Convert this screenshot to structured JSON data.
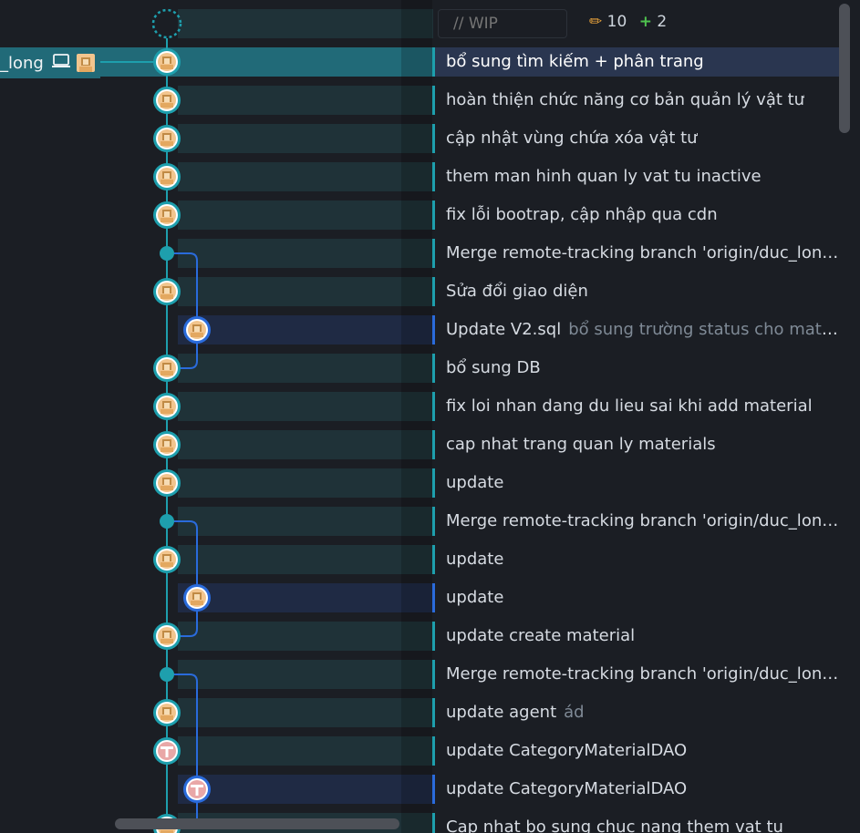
{
  "wip": {
    "placeholder": "// WIP",
    "edit_count": "10",
    "add_count": "2"
  },
  "branch": {
    "label": "_long"
  },
  "commits": [
    {
      "message": "bổ sung tìm kiếm + phân trang",
      "sub": "",
      "lane": 0,
      "avatar": "face",
      "selected": true
    },
    {
      "message": "hoàn thiện chức năng cơ bản quản lý vật tư",
      "sub": "",
      "lane": 0,
      "avatar": "face"
    },
    {
      "message": "cập nhật vùng chứa xóa vật tư",
      "sub": "",
      "lane": 0,
      "avatar": "face"
    },
    {
      "message": "them man hinh quan ly vat tu inactive",
      "sub": "",
      "lane": 0,
      "avatar": "face"
    },
    {
      "message": "fix lỗi bootrap, cập nhập qua cdn",
      "sub": "",
      "lane": 0,
      "avatar": "face"
    },
    {
      "message": "Merge remote-tracking branch 'origin/duc_long' in...",
      "sub": "",
      "lane": 0,
      "avatar": "merge"
    },
    {
      "message": "Sửa đổi giao diện",
      "sub": "",
      "lane": 0,
      "avatar": "face"
    },
    {
      "message": "Update V2.sql",
      "sub": "bổ sung trường status cho material",
      "lane": 1,
      "avatar": "face"
    },
    {
      "message": "bổ sung DB",
      "sub": "",
      "lane": 0,
      "avatar": "face"
    },
    {
      "message": "fix loi nhan dang du lieu sai khi add material",
      "sub": "",
      "lane": 0,
      "avatar": "face"
    },
    {
      "message": "cap nhat trang quan ly materials",
      "sub": "",
      "lane": 0,
      "avatar": "face"
    },
    {
      "message": "update",
      "sub": "",
      "lane": 0,
      "avatar": "face"
    },
    {
      "message": "Merge remote-tracking branch 'origin/duc_long' in...",
      "sub": "",
      "lane": 0,
      "avatar": "merge"
    },
    {
      "message": "update",
      "sub": "",
      "lane": 0,
      "avatar": "face"
    },
    {
      "message": "update",
      "sub": "",
      "lane": 1,
      "avatar": "face"
    },
    {
      "message": "update create material",
      "sub": "",
      "lane": 0,
      "avatar": "face"
    },
    {
      "message": "Merge remote-tracking branch 'origin/duc_long' in...",
      "sub": "",
      "lane": 0,
      "avatar": "merge"
    },
    {
      "message": "update agent",
      "sub": "ád",
      "lane": 0,
      "avatar": "face"
    },
    {
      "message": "update CategoryMaterialDAO",
      "sub": "",
      "lane": 0,
      "avatar": "T"
    },
    {
      "message": "update CategoryMaterialDAO",
      "sub": "",
      "lane": 1,
      "avatar": "T"
    },
    {
      "message": "Cap nhat bo sung chuc nang them vat tu",
      "sub": "",
      "lane": 0,
      "avatar": "face"
    }
  ],
  "colors": {
    "lane0": "#1e9fad",
    "lane1": "#2a6bdb",
    "avatar_face": "#f2c58e",
    "avatar_T": "#e9a7a7"
  }
}
